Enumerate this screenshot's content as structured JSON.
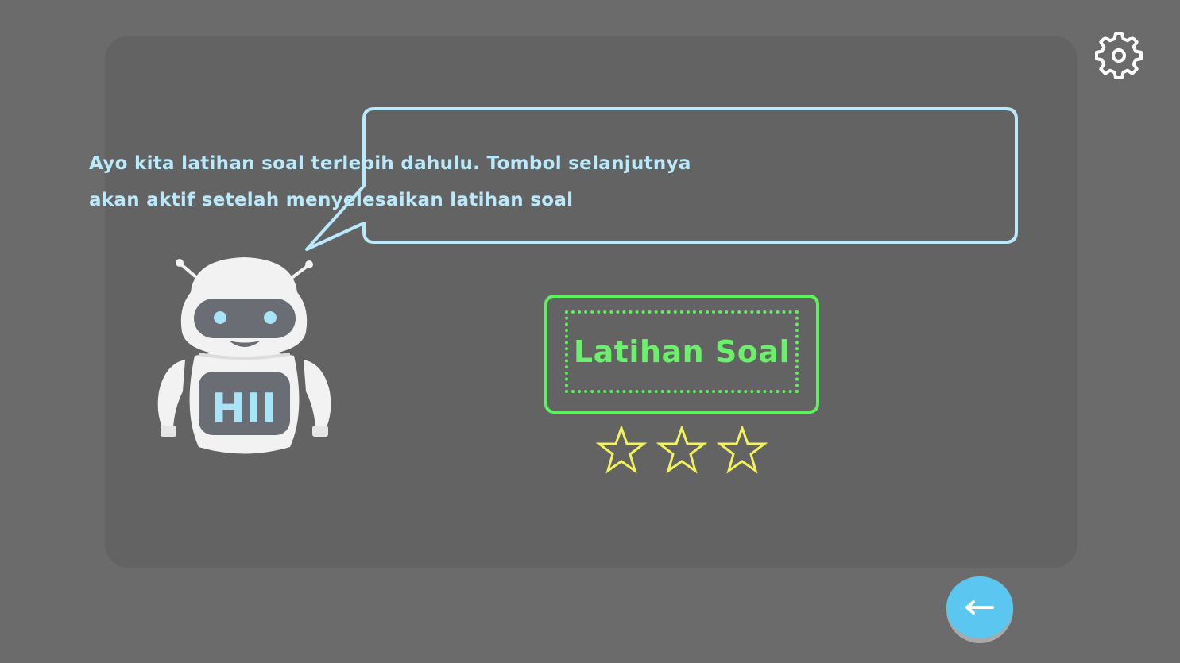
{
  "speech": {
    "text": "Ayo kita latihan soal terlebih dahulu. Tombol selanjutnya akan aktif setelah menyelesaikan latihan soal"
  },
  "robot": {
    "chest_label": "HII"
  },
  "practice": {
    "label": "Latihan Soal",
    "stars_total": 3,
    "stars_earned": 0
  },
  "icons": {
    "settings": "gear-icon",
    "back": "arrow-left-icon",
    "star": "star-outline-icon"
  },
  "colors": {
    "background": "#6b6b6b",
    "card": "#636363",
    "bubble_border": "#b9e9fb",
    "practice_accent": "#5cf25c",
    "star": "#f2f25a",
    "back_button": "#5bc6ef"
  }
}
